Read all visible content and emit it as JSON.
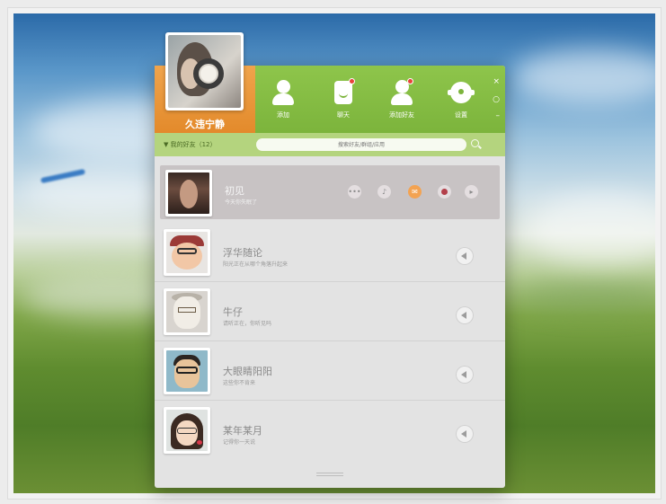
{
  "colors": {
    "header_green": "#7cb43c",
    "profile_orange": "#e38a2b",
    "search_bar_green": "#b4d47e",
    "list_background": "#e3e3e3",
    "active_row": "#c8c3c4"
  },
  "profile": {
    "name": "久违宁静",
    "avatar_icon": "headphones-avatar"
  },
  "nav": [
    {
      "label": "添加",
      "icon": "person-icon"
    },
    {
      "label": "聊天",
      "icon": "chat-icon"
    },
    {
      "label": "添加好友",
      "icon": "add-friend-icon"
    },
    {
      "label": "设置",
      "icon": "gear-icon"
    }
  ],
  "window_controls": [
    "×",
    "○",
    "–"
  ],
  "search": {
    "group_label": "▼  我的好友（12）",
    "placeholder": "搜索好友/群组/应用"
  },
  "contacts": [
    {
      "name": "初见",
      "status": "今天你失眠了",
      "active": true
    },
    {
      "name": "浮华随论",
      "status": "阳光正在从哪个角落升起来",
      "active": false
    },
    {
      "name": "牛仔",
      "status": "请听正在，你听见吗",
      "active": false
    },
    {
      "name": "大眼睛阳阳",
      "status": "这些你不肯来",
      "active": false
    },
    {
      "name": "某年某月",
      "status": "记得你一天说",
      "active": false
    }
  ],
  "active_actions": [
    "more-icon",
    "music-icon",
    "mail-icon",
    "record-icon",
    "play-icon"
  ]
}
